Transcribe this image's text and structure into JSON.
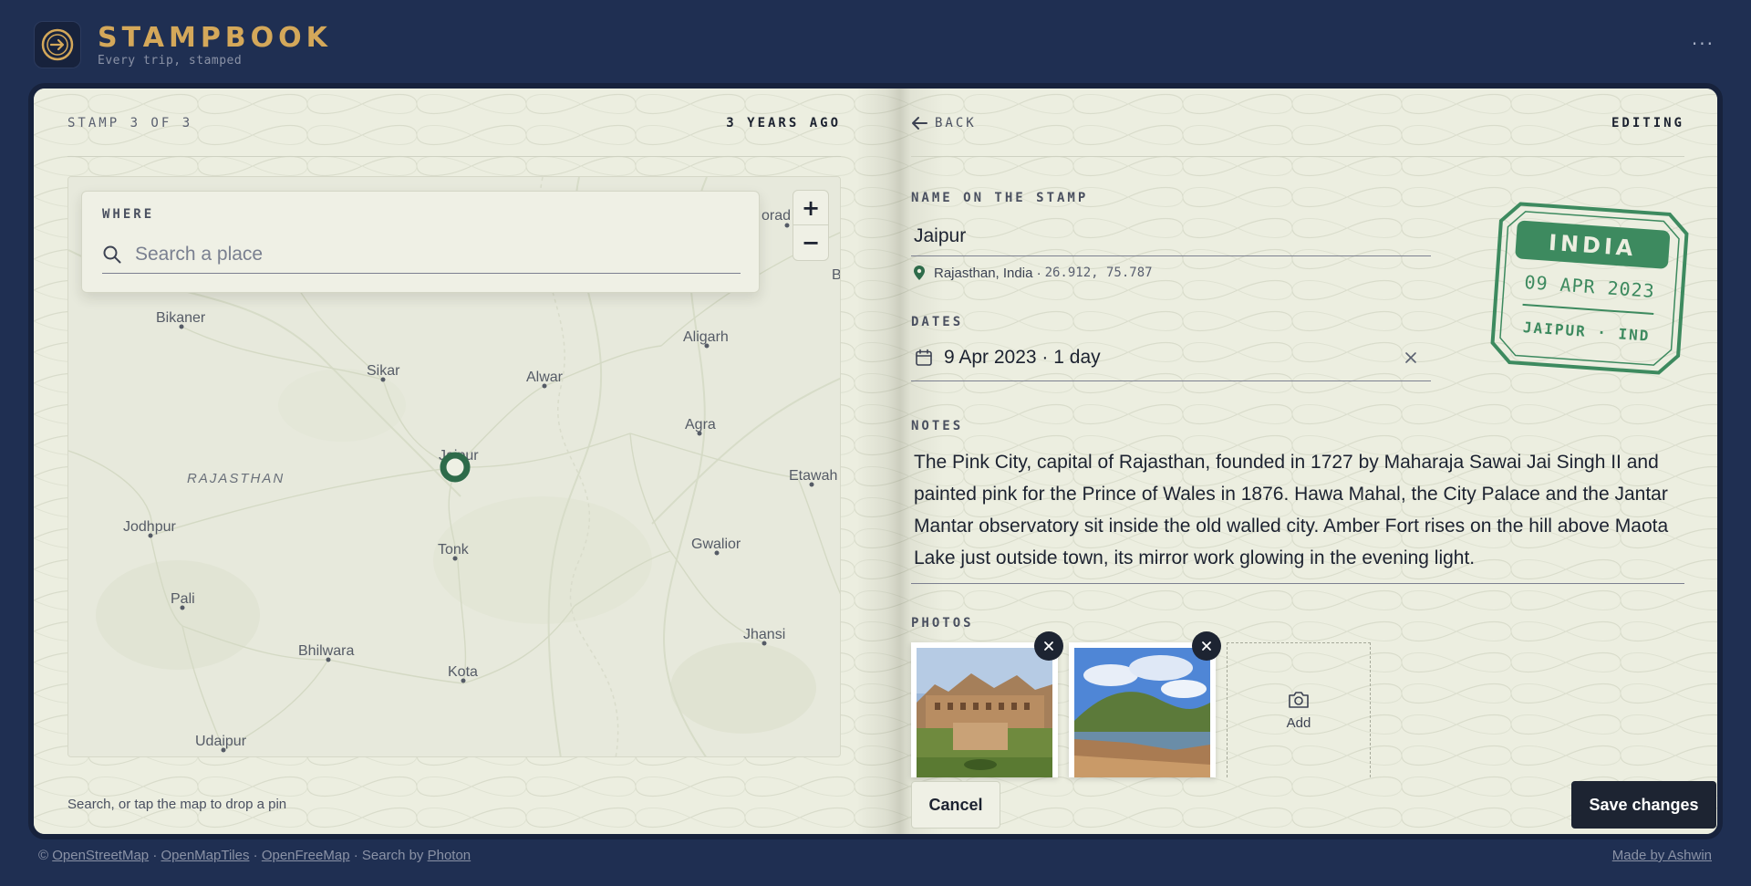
{
  "header": {
    "title": "STAMPBOOK",
    "subtitle": "Every trip, stamped",
    "more_label": "···"
  },
  "left_page": {
    "stamp_count": "STAMP 3 OF 3",
    "age": "3 YEARS AGO",
    "where_label": "WHERE",
    "search_placeholder": "Search a place",
    "zoom_in": "+",
    "zoom_out": "−",
    "hint": "Search, or tap the map to drop a pin",
    "map": {
      "region_label": "RAJASTHAN",
      "cities": [
        {
          "name": "Bikaner"
        },
        {
          "name": "Sikar"
        },
        {
          "name": "Alwar"
        },
        {
          "name": "Aligarh"
        },
        {
          "name": "Agra"
        },
        {
          "name": "Jaipur"
        },
        {
          "name": "Etawah"
        },
        {
          "name": "Jodhpur"
        },
        {
          "name": "Tonk"
        },
        {
          "name": "Gwalior"
        },
        {
          "name": "Pali"
        },
        {
          "name": "Bhilwara"
        },
        {
          "name": "Kota"
        },
        {
          "name": "Jhansi"
        },
        {
          "name": "Udaipur"
        }
      ],
      "edge_labels": {
        "top_right": "orad",
        "right": "B"
      },
      "pin_color": "#2e6b4a"
    }
  },
  "right_page": {
    "back_label": "BACK",
    "mode_label": "EDITING",
    "name_label": "NAME ON THE STAMP",
    "name_value": "Jaipur",
    "location": "Rajasthan, India ·",
    "coords": "26.912, 75.787",
    "dates_label": "DATES",
    "dates_value": "9 Apr 2023 · 1 day",
    "notes_label": "NOTES",
    "notes_text": "The Pink City, capital of Rajasthan, founded in 1727 by Maharaja Sawai Jai Singh II and painted pink for the Prince of Wales in 1876. Hawa Mahal, the City Palace and the Jantar Mantar observatory sit inside the old walled city. Amber Fort rises on the hill above Maota Lake just outside town, its mirror work glowing in the evening light.",
    "photos_label": "PHOTOS",
    "add_photo_label": "Add",
    "cancel_label": "Cancel",
    "save_label": "Save changes",
    "stamp": {
      "country": "INDIA",
      "date": "09 APR 2023",
      "place": "JAIPUR · IND",
      "color": "#3d8a5f"
    }
  },
  "footer": {
    "copyright": "©",
    "links": [
      "OpenStreetMap",
      "OpenMapTiles",
      "OpenFreeMap"
    ],
    "sep": "·",
    "search_by": "Search by",
    "search_link": "Photon",
    "made_by": "Made by Ashwin"
  },
  "colors": {
    "background": "#1f2f52",
    "page": "#eceee0",
    "accent_gold": "#d4a85a",
    "stamp_green": "#3d8a5f",
    "button_dark": "#1d2432"
  }
}
